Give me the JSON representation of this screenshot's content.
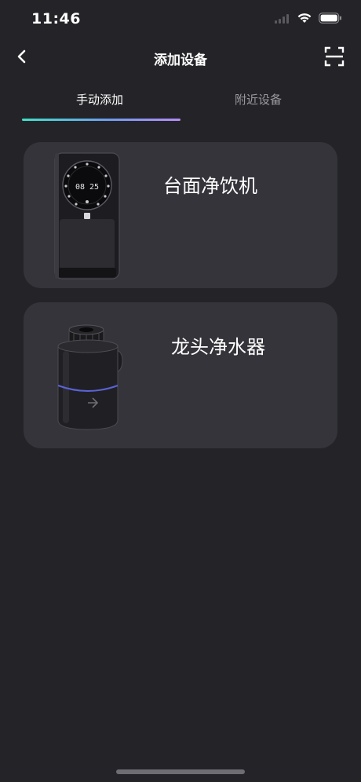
{
  "status_bar": {
    "time": "11:46"
  },
  "nav": {
    "title": "添加设备",
    "back_icon": "chevron-left-icon",
    "scan_icon": "scan-icon"
  },
  "tabs": [
    {
      "label": "手动添加",
      "active": true
    },
    {
      "label": "附近设备",
      "active": false
    }
  ],
  "devices": [
    {
      "name": "台面净饮机",
      "image": "countertop-purifier-image",
      "display_text": "08 25"
    },
    {
      "name": "龙头净水器",
      "image": "faucet-filter-image"
    }
  ],
  "colors": {
    "background": "#242428",
    "card": "#34343a",
    "tab_inactive": "#9a9aa0",
    "indicator_start": "#3fe0c8",
    "indicator_end": "#b58cf4"
  }
}
